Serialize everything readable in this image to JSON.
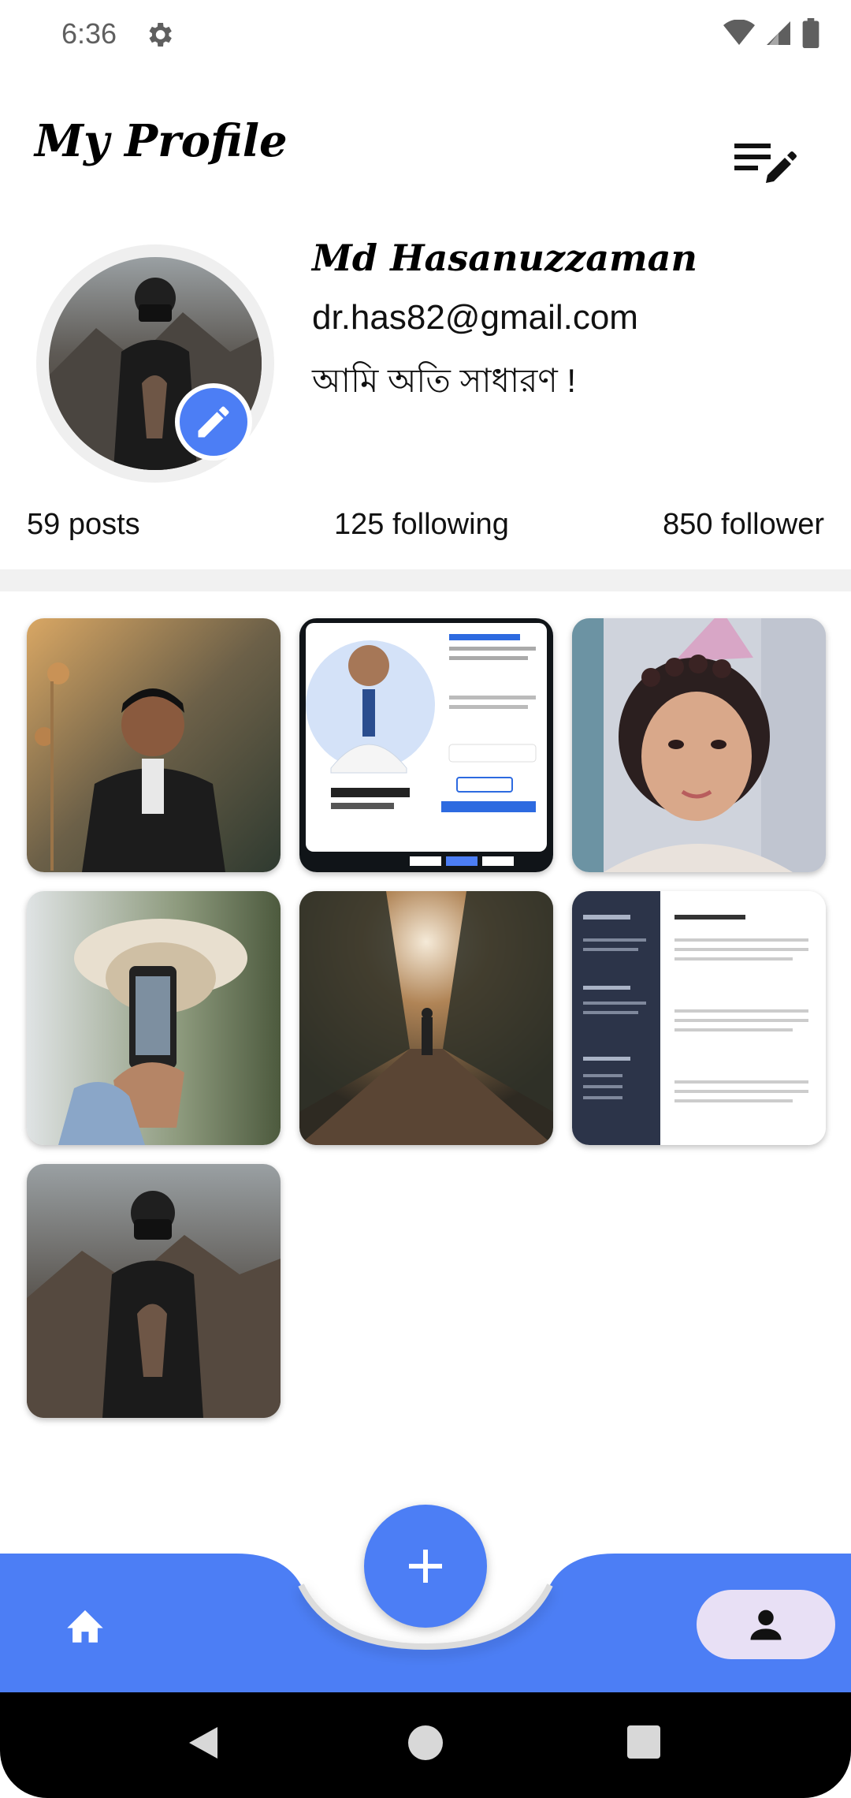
{
  "status_bar": {
    "time": "6:36",
    "icons": [
      "gear-icon",
      "wifi-icon",
      "cell-signal-icon",
      "battery-icon"
    ]
  },
  "app_bar": {
    "title": "My Profile",
    "action_icon": "edit-list-icon"
  },
  "profile": {
    "name": "Md Hasanuzzaman",
    "email": "dr.has82@gmail.com",
    "bio": "আমি অতি সাধারণ !",
    "edit_icon": "pencil-icon"
  },
  "stats": {
    "posts": "59 posts",
    "following": "125 following",
    "followers": "850 follower"
  },
  "posts": [
    {
      "subject": "man-in-leather-jacket"
    },
    {
      "subject": "doctor-profile-card"
    },
    {
      "subject": "girl-with-party-hat"
    },
    {
      "subject": "man-with-phone"
    },
    {
      "subject": "person-in-forest-path"
    },
    {
      "subject": "resume-document"
    },
    {
      "subject": "photographer-with-camera"
    }
  ],
  "bottom_nav": {
    "home_icon": "home-icon",
    "add_icon": "plus-icon",
    "profile_icon": "person-icon"
  },
  "colors": {
    "accent": "#4c7ef5",
    "profile_pill": "#e8e0f5",
    "divider": "#f1f1f1"
  }
}
